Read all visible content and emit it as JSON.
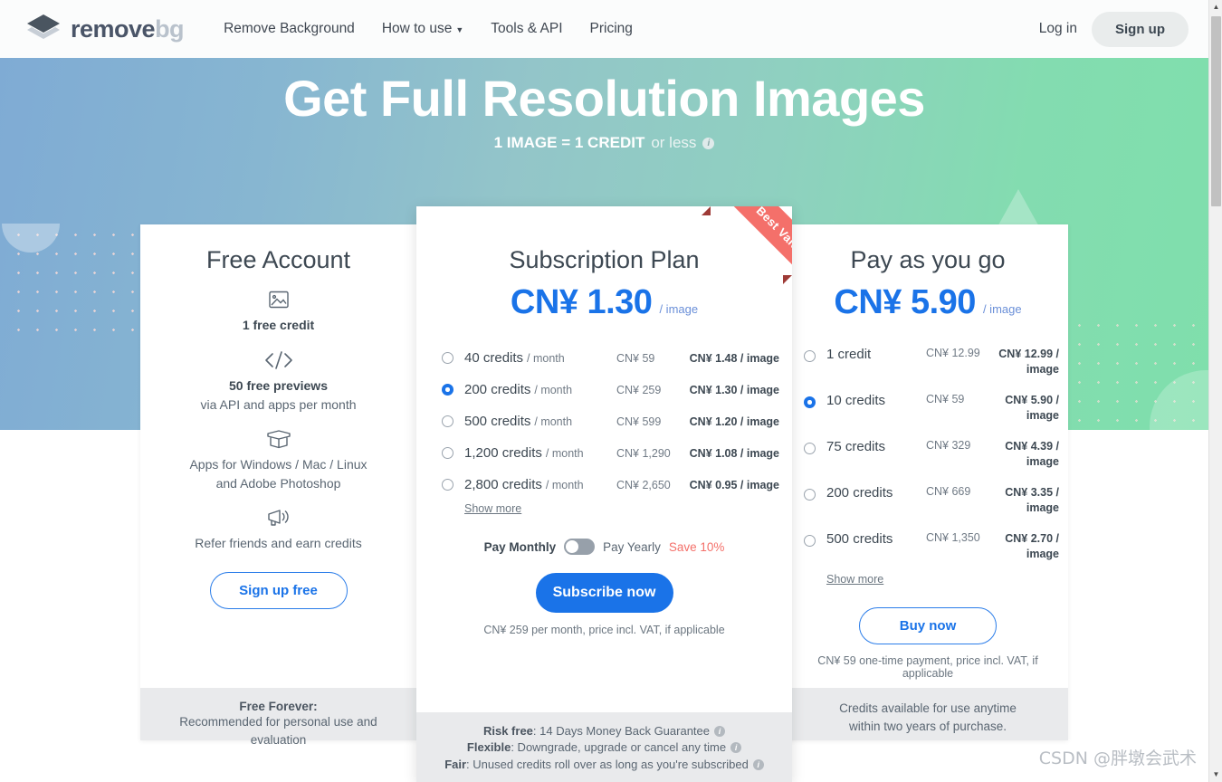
{
  "header": {
    "logo": {
      "name": "remove",
      "suffix": "bg",
      "icon": "layers-diamond-icon"
    },
    "nav": [
      {
        "label": "Remove Background",
        "has_caret": false
      },
      {
        "label": "How to use",
        "has_caret": true
      },
      {
        "label": "Tools & API",
        "has_caret": false
      },
      {
        "label": "Pricing",
        "has_caret": false
      }
    ],
    "login_label": "Log in",
    "signup_label": "Sign up"
  },
  "hero": {
    "title": "Get Full Resolution Images",
    "sub_strong": "1 IMAGE = 1 CREDIT",
    "sub_light": "or less",
    "info_glyph": "i"
  },
  "free_card": {
    "title": "Free Account",
    "features": [
      {
        "icon": "image-icon",
        "label": "1 free credit",
        "sub": ""
      },
      {
        "icon": "code-brackets-icon",
        "label": "50 free previews",
        "sub": "via API and apps per month"
      },
      {
        "icon": "open-box-icon",
        "label": "",
        "sub": "Apps for Windows / Mac / Linux\nand Adobe Photoshop"
      },
      {
        "icon": "megaphone-icon",
        "label": "",
        "sub": "Refer friends and earn credits"
      }
    ],
    "feature3_line1": "Apps for Windows / Mac / Linux",
    "feature3_line2": "and Adobe Photoshop",
    "feature4_text": "Refer friends and earn credits",
    "button_label": "Sign up free",
    "footer_strong": "Free Forever:",
    "footer_text": "Recommended for personal use and evaluation"
  },
  "subscription_card": {
    "ribbon_label": "Best Value",
    "title": "Subscription Plan",
    "price": "CN¥ 1.30",
    "price_unit": "/ image",
    "options": [
      {
        "name": "40 credits",
        "per": "/ month",
        "total": "CN¥ 59",
        "each": "CN¥ 1.48 / image",
        "selected": false
      },
      {
        "name": "200 credits",
        "per": "/ month",
        "total": "CN¥ 259",
        "each": "CN¥ 1.30 / image",
        "selected": true
      },
      {
        "name": "500 credits",
        "per": "/ month",
        "total": "CN¥ 599",
        "each": "CN¥ 1.20 / image",
        "selected": false
      },
      {
        "name": "1,200 credits",
        "per": "/ month",
        "total": "CN¥ 1,290",
        "each": "CN¥ 1.08 / image",
        "selected": false
      },
      {
        "name": "2,800 credits",
        "per": "/ month",
        "total": "CN¥ 2,650",
        "each": "CN¥ 0.95 / image",
        "selected": false
      }
    ],
    "show_more": "Show more",
    "toggle": {
      "monthly_label": "Pay Monthly",
      "yearly_label": "Pay Yearly",
      "save_label": "Save 10%",
      "state": "monthly"
    },
    "button_label": "Subscribe now",
    "note": "CN¥ 259 per month, price incl. VAT, if applicable",
    "footer": [
      {
        "strong": "Risk free",
        "text": ": 14 Days Money Back Guarantee",
        "info": "i"
      },
      {
        "strong": "Flexible",
        "text": ": Downgrade, upgrade or cancel any time",
        "info": "i"
      },
      {
        "strong": "Fair",
        "text": ": Unused credits roll over as long as you're subscribed",
        "info": "i"
      }
    ]
  },
  "payg_card": {
    "title": "Pay as you go",
    "price": "CN¥ 5.90",
    "price_unit": "/ image",
    "options": [
      {
        "name": "1 credit",
        "total": "CN¥ 12.99",
        "each": "CN¥ 12.99 / image",
        "selected": false
      },
      {
        "name": "10 credits",
        "total": "CN¥ 59",
        "each": "CN¥ 5.90 / image",
        "selected": true
      },
      {
        "name": "75 credits",
        "total": "CN¥ 329",
        "each": "CN¥ 4.39 / image",
        "selected": false
      },
      {
        "name": "200 credits",
        "total": "CN¥ 669",
        "each": "CN¥ 3.35 / image",
        "selected": false
      },
      {
        "name": "500 credits",
        "total": "CN¥ 1,350",
        "each": "CN¥ 2.70 / image",
        "selected": false
      }
    ],
    "show_more": "Show more",
    "button_label": "Buy now",
    "note": "CN¥ 59 one-time payment, price incl. VAT, if applicable",
    "footer_line1": "Credits available for use anytime",
    "footer_line2": "within two years of purchase."
  },
  "watermark": "CSDN @胖墩会武术",
  "colors": {
    "accent_blue": "#1a73e8",
    "ribbon_red": "#f4706a",
    "hero_left": "#7fabd4",
    "hero_right": "#7fdfac",
    "footer_gray": "#e9eaec"
  }
}
